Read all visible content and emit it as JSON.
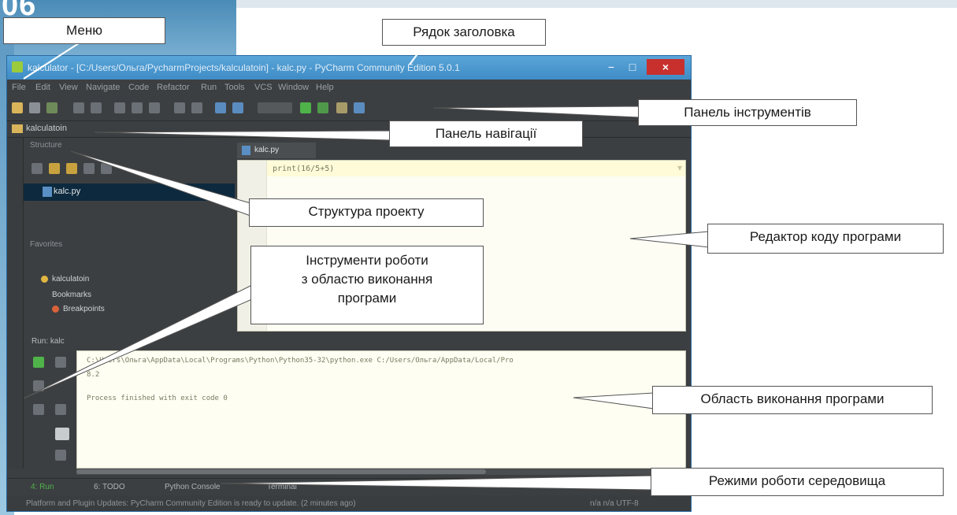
{
  "page_number": "06",
  "ide": {
    "title_text": "kalculator - [C:/Users/Ольга/PycharmProjects/kalculatoin] - kalc.py - PyCharm Community Edition 5.0.1",
    "window_buttons": {
      "minimize": "−",
      "maximize": "□",
      "close": "×"
    },
    "menu": [
      "File",
      "Edit",
      "View",
      "Navigate",
      "Code",
      "Refactor",
      "Run",
      "Tools",
      "VCS",
      "Window",
      "Help"
    ],
    "nav_path": "kalculatoin",
    "structure_title": "Structure",
    "structure_file": "kalc.py",
    "favorites_title": "Favorites",
    "favorites_items": [
      "kalculatoin",
      "Bookmarks",
      "Breakpoints"
    ],
    "editor_tab": "kalc.py",
    "code_line": "print(16/5+5)",
    "run_label": "Run: kalc",
    "console_lines": [
      "C:\\Users\\Ольга\\AppData\\Local\\Programs\\Python\\Python35-32\\python.exe C:/Users/Ольга/AppData/Local/Pro",
      "8.2",
      "Process finished with exit code 0"
    ],
    "tool_tabs": [
      "4: Run",
      "6: TODO",
      "Python Console",
      "Terminal"
    ],
    "status_text": "Platform and Plugin Updates: PyCharm Community Edition is ready to update. (2 minutes ago)",
    "status_right": "n/a   n/a   UTF-8"
  },
  "callouts": {
    "menu": "Меню",
    "title_bar": "Рядок заголовка",
    "toolbar": "Панель інструментів",
    "navbar": "Панель навігації",
    "project_structure": "Структура проекту",
    "code_editor": "Редактор коду програми",
    "run_tools": [
      "Інструменти роботи",
      "з областю виконання",
      "програми"
    ],
    "run_area": "Область виконання програми",
    "modes": "Режими роботи середовища"
  }
}
